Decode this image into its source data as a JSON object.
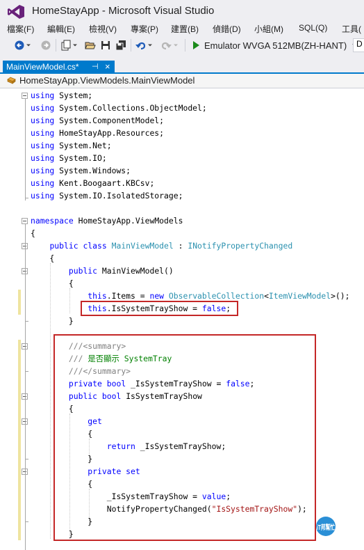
{
  "window": {
    "title": "HomeStayApp - Microsoft Visual Studio"
  },
  "menu": [
    {
      "name": "menu-file",
      "label": "檔案(F)"
    },
    {
      "name": "menu-edit",
      "label": "編輯(E)"
    },
    {
      "name": "menu-view",
      "label": "檢視(V)"
    },
    {
      "name": "menu-project",
      "label": "專案(P)"
    },
    {
      "name": "menu-build",
      "label": "建置(B)"
    },
    {
      "name": "menu-debug",
      "label": "偵錯(D)"
    },
    {
      "name": "menu-team",
      "label": "小組(M)"
    },
    {
      "name": "menu-sql",
      "label": "SQL(Q)"
    },
    {
      "name": "menu-tools",
      "label": "工具("
    }
  ],
  "toolbar": {
    "run_target": "Emulator WVGA 512MB(ZH-HANT)",
    "platform_partial": "D"
  },
  "tab": {
    "label": "MainViewModel.cs*",
    "pin": "⊣",
    "close": "×"
  },
  "navbar": {
    "label": "HomeStayApp.ViewModels.MainViewModel"
  },
  "icons": {
    "run": "play-triangle",
    "back": "circle-arrow-left",
    "forward": "circle-arrow-right",
    "new-project": "new-project",
    "open-file": "folder-open",
    "save": "floppy",
    "save-all": "floppies",
    "undo": "undo-arrow",
    "redo": "redo-arrow",
    "nav-class": "class-icon"
  },
  "colors": {
    "keyword": "#0000ff",
    "type": "#2b91af",
    "comment": "#008000",
    "doc_tag": "#808080",
    "string": "#a31515",
    "tab_active": "#007acc",
    "highlight_box": "#c42727",
    "change_bar": "#efe49f"
  },
  "code_lines": [
    [
      [
        "kw",
        "using"
      ],
      [
        "",
        "System;"
      ]
    ],
    [
      [
        "kw",
        "using"
      ],
      [
        "",
        "System.Collections.ObjectModel;"
      ]
    ],
    [
      [
        "kw",
        "using"
      ],
      [
        "",
        "System.ComponentModel;"
      ]
    ],
    [
      [
        "kw",
        "using"
      ],
      [
        "",
        "HomeStayApp.Resources;"
      ]
    ],
    [
      [
        "kw",
        "using"
      ],
      [
        "",
        "System.Net;"
      ]
    ],
    [
      [
        "kw",
        "using"
      ],
      [
        "",
        "System.IO;"
      ]
    ],
    [
      [
        "kw",
        "using"
      ],
      [
        "",
        "System.Windows;"
      ]
    ],
    [
      [
        "kw",
        "using"
      ],
      [
        "",
        "Kent.Boogaart.KBCsv;"
      ]
    ],
    [
      [
        "kw",
        "using"
      ],
      [
        "",
        "System.IO.IsolatedStorage;"
      ]
    ],
    [],
    [
      [
        "kw",
        "namespace"
      ],
      [
        "",
        "HomeStayApp.ViewModels"
      ]
    ],
    [
      [
        "",
        "{"
      ]
    ],
    [
      [
        "",
        "    "
      ],
      [
        "kw",
        "public"
      ],
      [
        "kw",
        "class"
      ],
      [
        "ty",
        "MainViewModel"
      ],
      [
        "",
        ":"
      ],
      [
        "ty",
        "INotifyPropertyChanged"
      ]
    ],
    [
      [
        "",
        "    {"
      ]
    ],
    [
      [
        "",
        "        "
      ],
      [
        "kw",
        "public"
      ],
      [
        "",
        "MainViewModel()"
      ]
    ],
    [
      [
        "",
        "        {"
      ]
    ],
    [
      [
        "",
        "            "
      ],
      [
        "kw",
        "this"
      ],
      [
        "",
        ".Items ="
      ],
      [
        "kw",
        "new"
      ],
      [
        "ty",
        "ObservableCollection"
      ],
      [
        "",
        "<"
      ],
      [
        "ty",
        "ItemViewModel"
      ],
      [
        "",
        ">();"
      ]
    ],
    [
      [
        "",
        "            "
      ],
      [
        "kw",
        "this"
      ],
      [
        "",
        ".IsSystemTrayShow ="
      ],
      [
        "kw",
        "false"
      ],
      [
        "",
        ";"
      ]
    ],
    [
      [
        "",
        "        }"
      ]
    ],
    [],
    [
      [
        "",
        "        "
      ],
      [
        "dc",
        "///"
      ],
      [
        "dc",
        "<summary>"
      ]
    ],
    [
      [
        "",
        "        "
      ],
      [
        "dc",
        "///"
      ],
      [
        "cm",
        "是否顯示 SystemTray"
      ]
    ],
    [
      [
        "",
        "        "
      ],
      [
        "dc",
        "///"
      ],
      [
        "dc",
        "</summary>"
      ]
    ],
    [
      [
        "",
        "        "
      ],
      [
        "kw",
        "private"
      ],
      [
        "kw",
        "bool"
      ],
      [
        "",
        "_IsSystemTrayShow ="
      ],
      [
        "kw",
        "false"
      ],
      [
        "",
        ";"
      ]
    ],
    [
      [
        "",
        "        "
      ],
      [
        "kw",
        "public"
      ],
      [
        "kw",
        "bool"
      ],
      [
        "",
        "IsSystemTrayShow"
      ]
    ],
    [
      [
        "",
        "        {"
      ]
    ],
    [
      [
        "",
        "            "
      ],
      [
        "kw",
        "get"
      ]
    ],
    [
      [
        "",
        "            {"
      ]
    ],
    [
      [
        "",
        "                "
      ],
      [
        "kw",
        "return"
      ],
      [
        "",
        "_IsSystemTrayShow;"
      ]
    ],
    [
      [
        "",
        "            }"
      ]
    ],
    [
      [
        "",
        "            "
      ],
      [
        "kw",
        "private"
      ],
      [
        "kw",
        "set"
      ]
    ],
    [
      [
        "",
        "            {"
      ]
    ],
    [
      [
        "",
        "                "
      ],
      [
        "",
        "_IsSystemTrayShow ="
      ],
      [
        "kw",
        "value"
      ],
      [
        "",
        ";"
      ]
    ],
    [
      [
        "",
        "                "
      ],
      [
        "",
        "NotifyPropertyChanged("
      ],
      [
        "st",
        "\"IsSystemTrayShow\""
      ],
      [
        "",
        ");"
      ]
    ],
    [
      [
        "",
        "            }"
      ]
    ],
    [
      [
        "",
        "        }"
      ]
    ]
  ],
  "watermark": {
    "text": "iT邦幫忙"
  }
}
